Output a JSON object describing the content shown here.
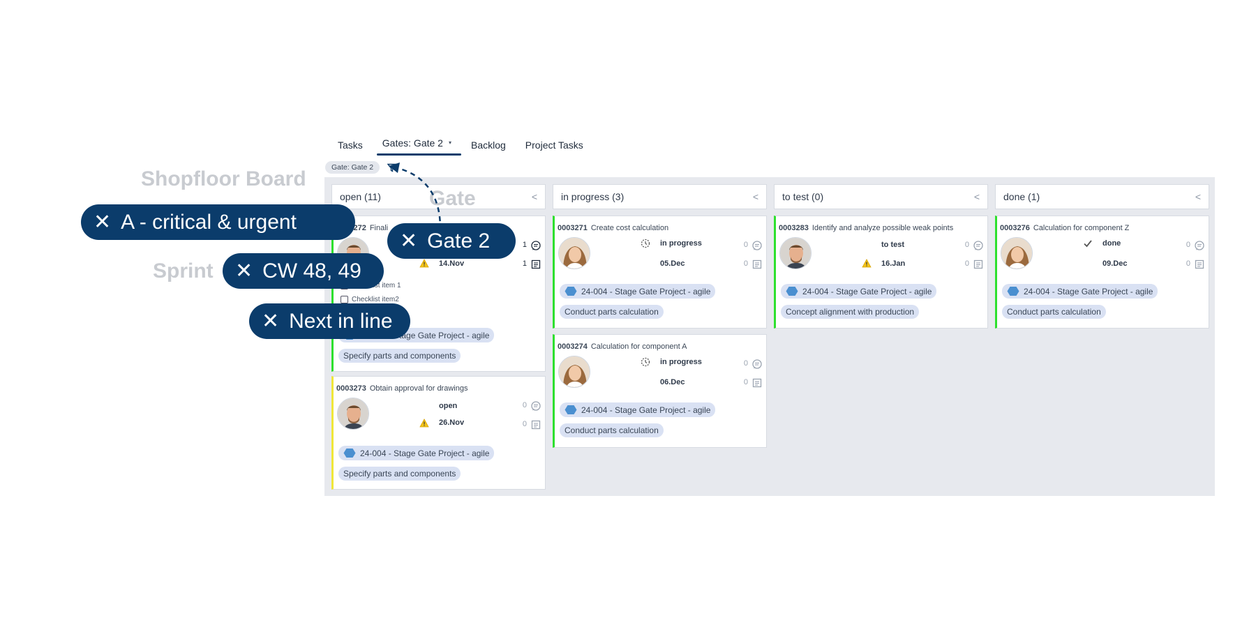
{
  "tabs": [
    {
      "label": "Tasks"
    },
    {
      "label": "Gates: Gate 2",
      "active": true
    },
    {
      "label": "Backlog"
    },
    {
      "label": "Project Tasks"
    }
  ],
  "filter_chip": "Gate: Gate 2",
  "side_labels": {
    "board": "Shopfloor Board",
    "gate": "Gate",
    "sprint": "Sprint"
  },
  "filter_pills": {
    "priority": "A - critical & urgent",
    "gate": "Gate 2",
    "sprint": "CW 48, 49",
    "next": "Next in line"
  },
  "columns": [
    {
      "header": "open (11)"
    },
    {
      "header": "in progress (3)"
    },
    {
      "header": "to test (0)"
    },
    {
      "header": "done (1)"
    }
  ],
  "cards": {
    "c3272": {
      "id": "0003272",
      "title": "Finali",
      "date": "14.Nov",
      "comments": "1",
      "notes": "1",
      "checklist1": "Checklist item 1",
      "checklist2": "Checklist item2",
      "project": "24-004 - Stage Gate Project - agile",
      "phase": "Specify parts and components"
    },
    "c3273": {
      "id": "0003273",
      "title": "Obtain approval for drawings",
      "status": "open",
      "date": "26.Nov",
      "comments": "0",
      "notes": "0",
      "project": "24-004 - Stage Gate Project - agile",
      "phase": "Specify parts and components"
    },
    "c3271": {
      "id": "0003271",
      "title": "Create cost calculation",
      "status": "in progress",
      "date": "05.Dec",
      "comments": "0",
      "notes": "0",
      "project": "24-004 - Stage Gate Project - agile",
      "phase": "Conduct parts calculation"
    },
    "c3274": {
      "id": "0003274",
      "title": "Calculation for component A",
      "status": "in progress",
      "date": "06.Dec",
      "comments": "0",
      "notes": "0",
      "project": "24-004 - Stage Gate Project - agile",
      "phase": "Conduct parts calculation"
    },
    "c3283": {
      "id": "0003283",
      "title": "Identify and analyze possible weak points",
      "status": "to test",
      "date": "16.Jan",
      "comments": "0",
      "notes": "0",
      "project": "24-004 - Stage Gate Project - agile",
      "phase": "Concept alignment with production"
    },
    "c3276": {
      "id": "0003276",
      "title": "Calculation for component Z",
      "status": "done",
      "date": "09.Dec",
      "comments": "0",
      "notes": "0",
      "project": "24-004 - Stage Gate Project - agile",
      "phase": "Conduct parts calculation"
    }
  },
  "colors": {
    "accent": "#0b3c6b",
    "board_bg": "#e7e9ee",
    "green_bar": "#2ee02e",
    "yellow_bar": "#f0e63a",
    "tag_bg": "#d9e1f3"
  }
}
